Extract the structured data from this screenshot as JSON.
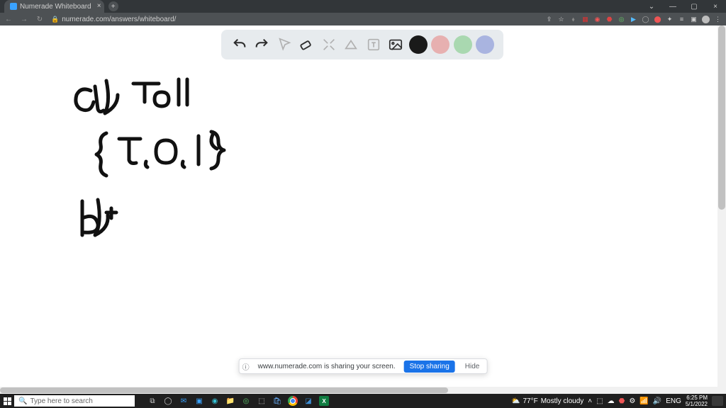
{
  "browser": {
    "tab_title": "Numerade Whiteboard",
    "url": "numerade.com/answers/whiteboard/"
  },
  "toolbar": {
    "undo": "undo",
    "redo": "redo",
    "pointer": "pointer",
    "eraser": "eraser",
    "tools": "tools",
    "highlight": "highlight",
    "text": "text",
    "image": "image"
  },
  "colors": {
    "black": "#1a1a1a",
    "red": "#e7b0b0",
    "green": "#a9d8b0",
    "blue": "#a9b4e0"
  },
  "share": {
    "message": "www.numerade.com is sharing your screen.",
    "stop": "Stop sharing",
    "hide": "Hide"
  },
  "taskbar": {
    "search_placeholder": "Type here to search",
    "weather_temp": "77°F",
    "weather_desc": "Mostly cloudy",
    "lang": "ENG",
    "time": "6:25 PM",
    "date": "5/1/2022"
  }
}
